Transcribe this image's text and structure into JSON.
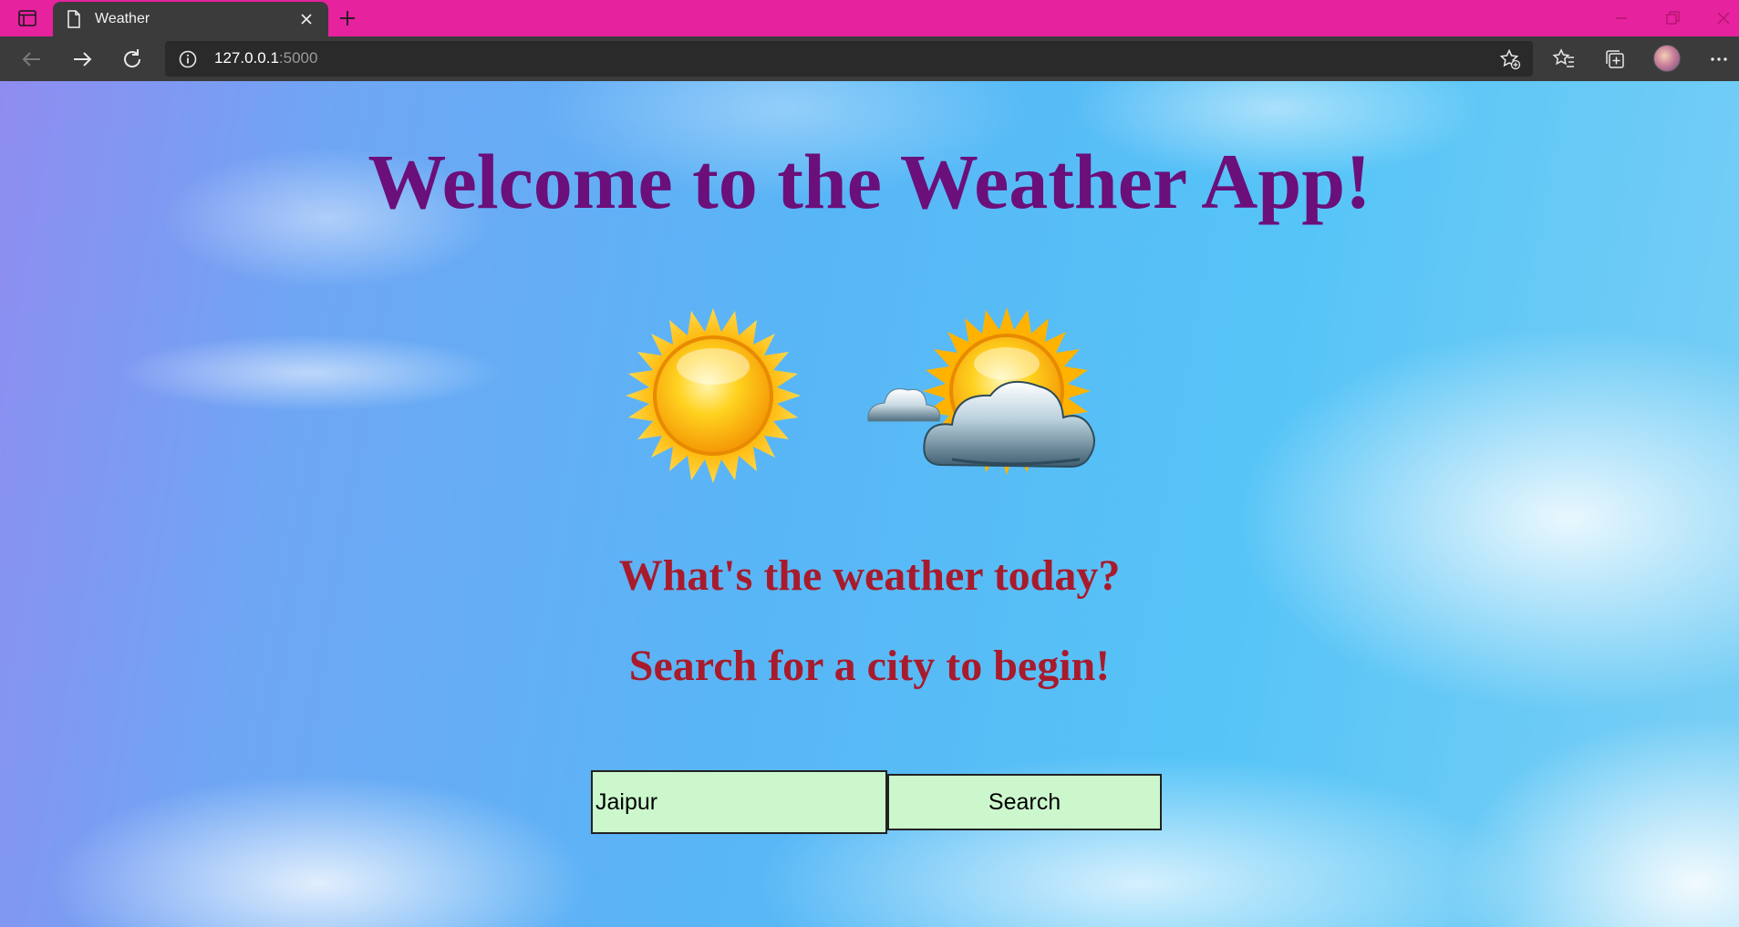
{
  "browser": {
    "tab_title": "Weather",
    "url_host": "127.0.0.1",
    "url_port": ":5000",
    "titlebar_color": "#e6229e",
    "icons": [
      "sidebar-toggle-icon",
      "page-icon",
      "close-icon",
      "new-tab-icon",
      "back-icon",
      "forward-icon",
      "refresh-icon",
      "info-icon",
      "add-favorite-icon",
      "favorites-icon",
      "collections-icon",
      "more-icon"
    ]
  },
  "page": {
    "heading": "Welcome to the Weather App!",
    "question": "What's the weather today?",
    "prompt": "Search for a city to begin!",
    "search": {
      "value": "Jaipur",
      "button_label": "Search"
    },
    "colors": {
      "heading": "#6b0f7a",
      "subtitle": "#a81b2c",
      "input_bg": "#ccf7cd"
    },
    "icons": [
      "sun-icon",
      "sun-behind-cloud-icon"
    ]
  }
}
